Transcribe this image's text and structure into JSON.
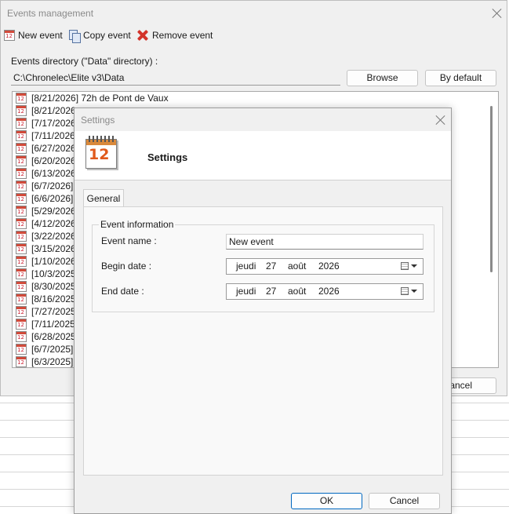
{
  "main_window": {
    "title": "Events management",
    "toolbar": {
      "new_event": "New event",
      "copy_event": "Copy event",
      "remove_event": "Remove event"
    },
    "directory_label": "Events directory (\"Data\" directory) :",
    "directory_value": "C:\\Chronelec\\Elite v3\\Data",
    "browse_label": "Browse",
    "by_default_label": "By default",
    "cancel_label": "Cancel",
    "cancel_visible": "ancel",
    "events": [
      "[8/21/2026] 72h de Pont de  Vaux",
      "[8/21/2026",
      "[7/17/2026",
      "[7/11/2026",
      "[6/27/2026",
      "[6/20/2026",
      "[6/13/2026",
      "[6/7/2026]",
      "[6/6/2026]",
      "[5/29/2026",
      "[4/12/2026",
      "[3/22/2026",
      "[3/15/2026",
      "[1/10/2026",
      "[10/3/2025",
      "[8/30/2025",
      "[8/16/2025",
      "[7/27/2025",
      "[7/11/2025",
      "[6/28/2025",
      "[6/7/2025]",
      "[6/3/2025]"
    ]
  },
  "settings_dialog": {
    "window_title": "Settings",
    "header_title": "Settings",
    "tab_general": "General",
    "group_title": "Event information",
    "event_name_label": "Event name :",
    "event_name_value": "New event",
    "begin_date_label": "Begin date :",
    "end_date_label": "End date :",
    "begin_date": {
      "weekday": "jeudi",
      "day": "27",
      "month": "août",
      "year": "2026"
    },
    "end_date": {
      "weekday": "jeudi",
      "day": "27",
      "month": "août",
      "year": "2026"
    },
    "ok_label": "OK",
    "cancel_label": "Cancel"
  },
  "icons": {
    "calendar": "calendar-icon",
    "copy": "copy-icon",
    "remove": "remove-icon",
    "close": "close-icon",
    "calendar_dropdown": "calendar-dropdown-icon"
  }
}
